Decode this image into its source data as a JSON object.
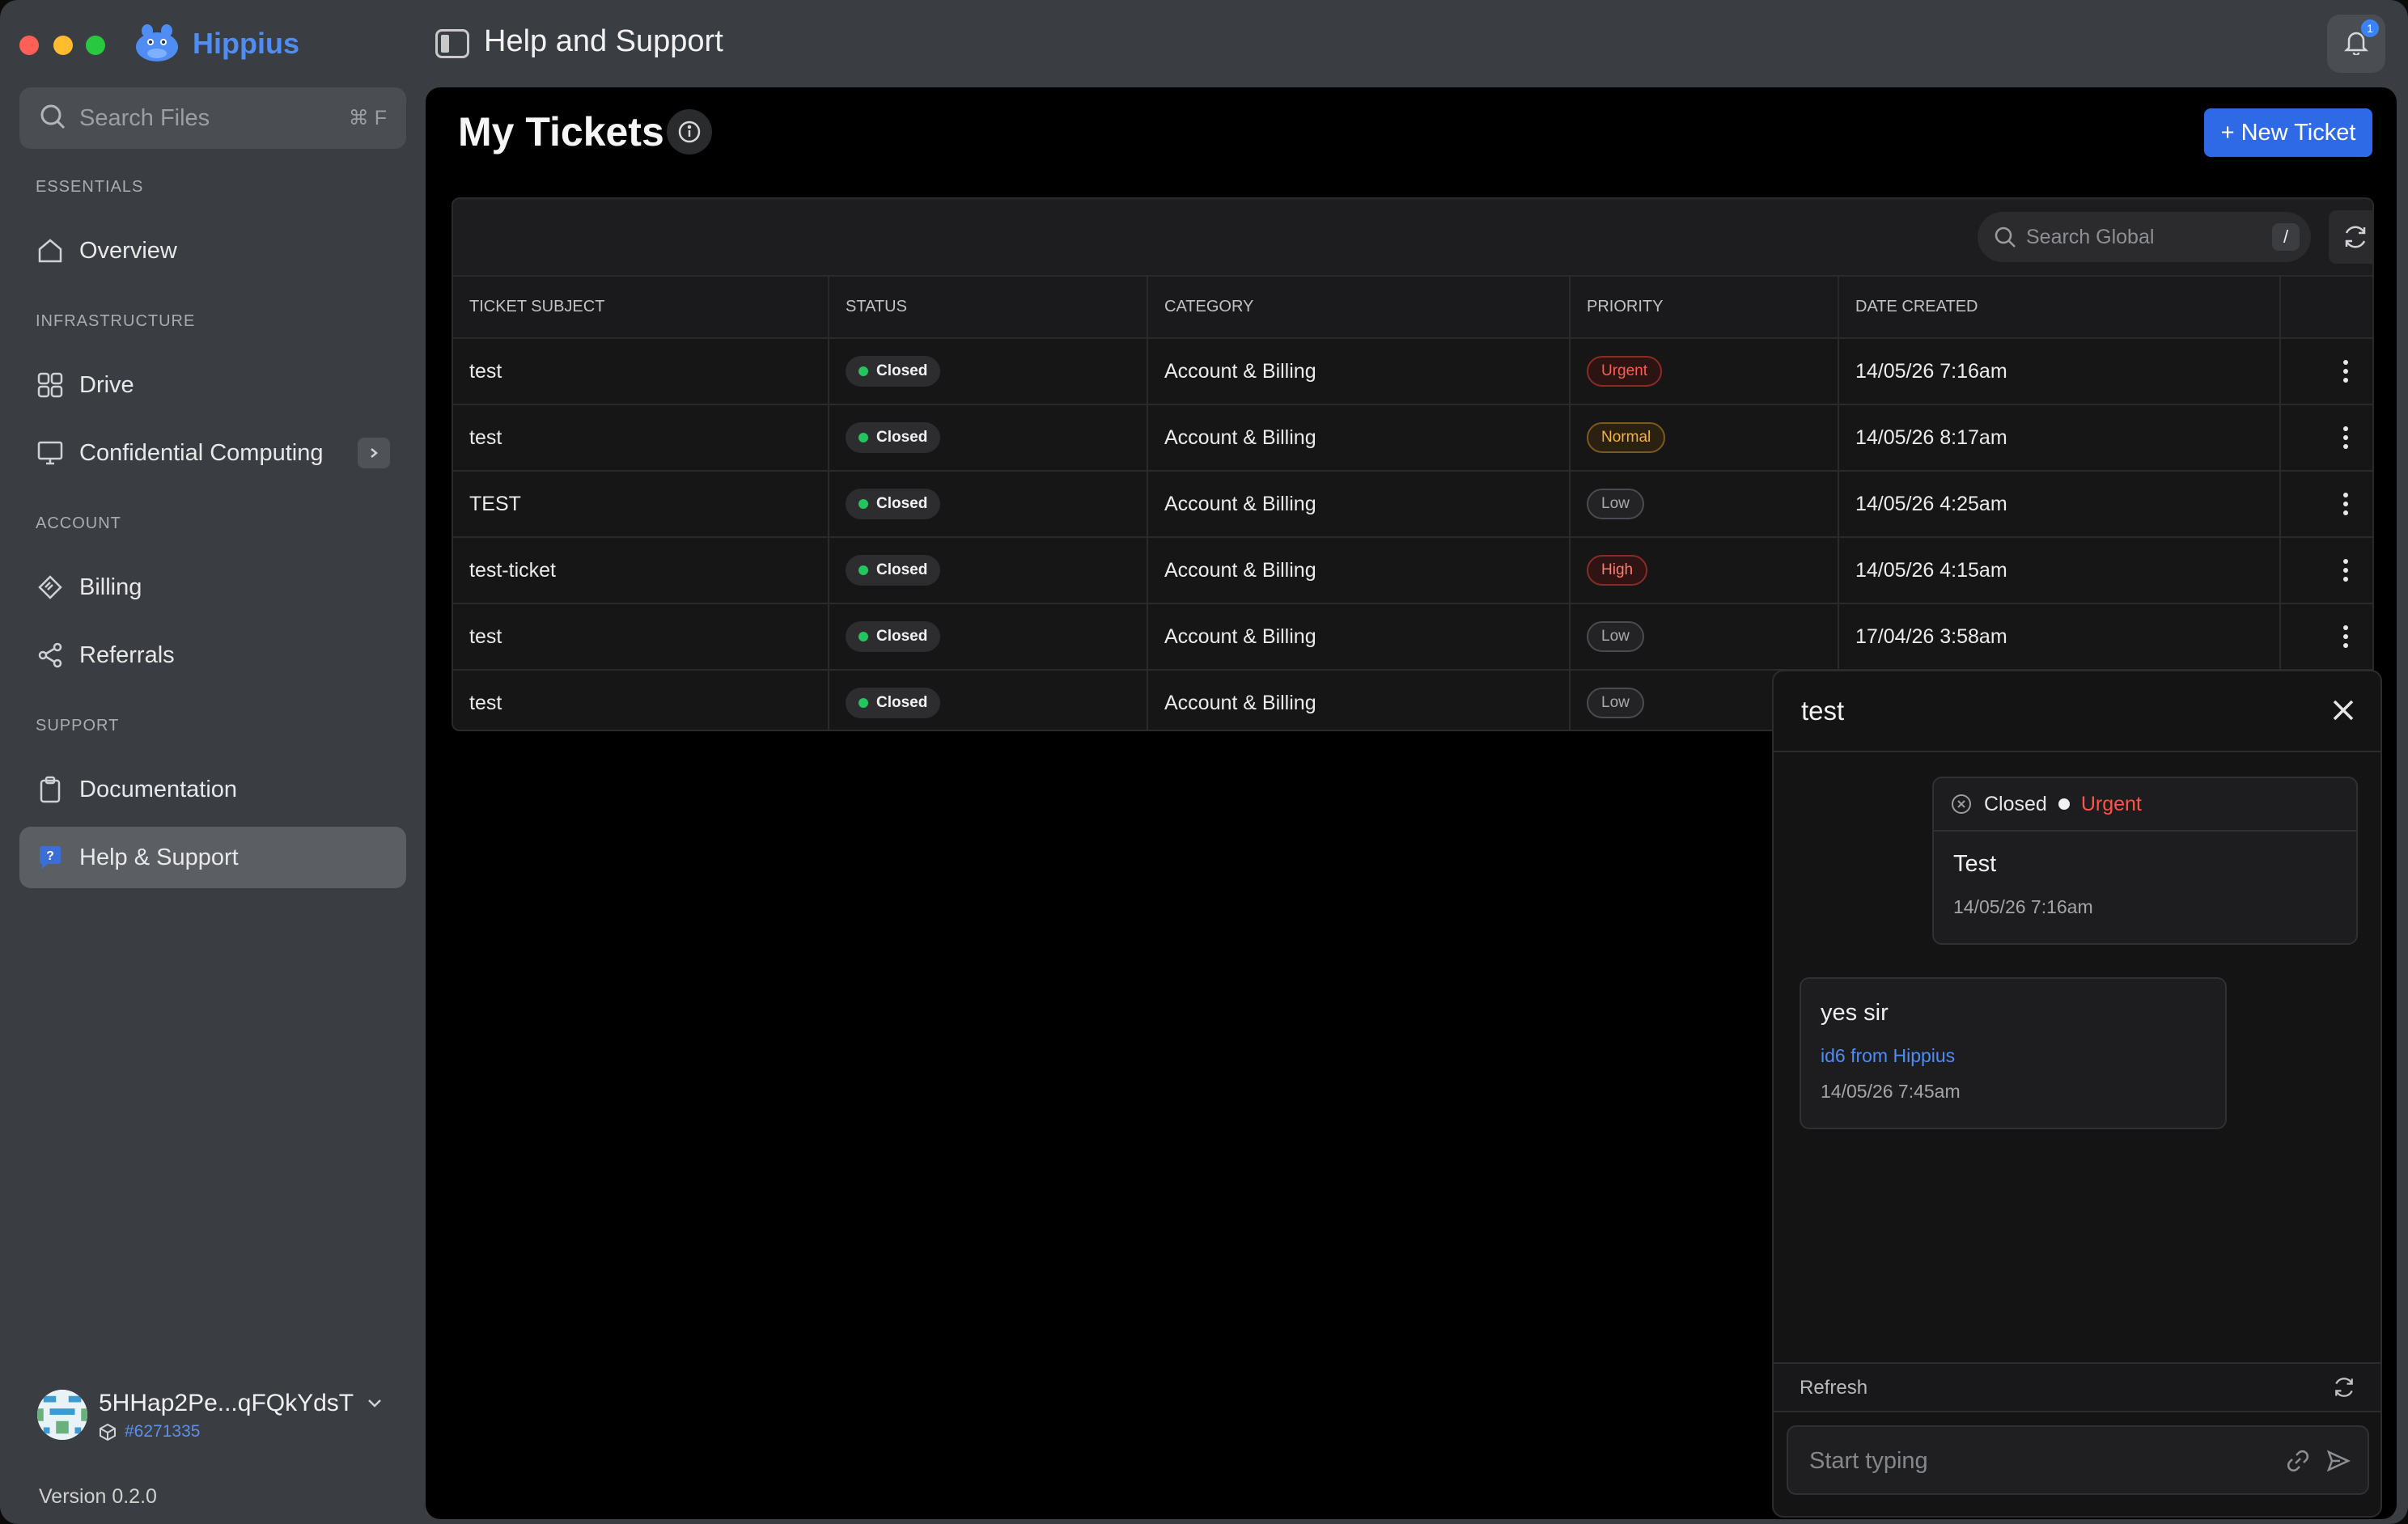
{
  "app": {
    "name": "Hippius",
    "page_heading": "Help and Support",
    "notification_count": "1",
    "accent": "#2f6ae6"
  },
  "sidebar": {
    "search": {
      "placeholder": "Search Files",
      "shortcut": "⌘ F"
    },
    "sections": {
      "essentials": "ESSENTIALS",
      "infrastructure": "INFRASTRUCTURE",
      "account": "ACCOUNT",
      "support": "SUPPORT"
    },
    "items": [
      {
        "label": "Overview",
        "icon": "home-icon"
      },
      {
        "label": "Drive",
        "icon": "grid-icon"
      },
      {
        "label": "Confidential Computing",
        "icon": "monitor-icon"
      },
      {
        "label": "Billing",
        "icon": "ticket-icon"
      },
      {
        "label": "Referrals",
        "icon": "share-icon"
      },
      {
        "label": "Documentation",
        "icon": "clipboard-icon"
      },
      {
        "label": "Help & Support",
        "icon": "help-chat-icon",
        "active": true
      }
    ],
    "account": {
      "name": "5HHap2Pe...qFQkYdsT",
      "id": "#6271335"
    },
    "version": "Version 0.2.0"
  },
  "main": {
    "title": "My Tickets",
    "new_ticket_label": "+ New Ticket",
    "search": {
      "placeholder": "Search Global",
      "shortcut": "/"
    },
    "columns": [
      "TICKET SUBJECT",
      "STATUS",
      "CATEGORY",
      "PRIORITY",
      "DATE CREATED"
    ],
    "rows": [
      {
        "subject": "test",
        "status": "Closed",
        "category": "Account & Billing",
        "priority": "Urgent",
        "date": "14/05/26 7:16am"
      },
      {
        "subject": "test",
        "status": "Closed",
        "category": "Account & Billing",
        "priority": "Normal",
        "date": "14/05/26 8:17am"
      },
      {
        "subject": "TEST",
        "status": "Closed",
        "category": "Account & Billing",
        "priority": "Low",
        "date": "14/05/26 4:25am"
      },
      {
        "subject": "test-ticket",
        "status": "Closed",
        "category": "Account & Billing",
        "priority": "High",
        "date": "14/05/26 4:15am"
      },
      {
        "subject": "test",
        "status": "Closed",
        "category": "Account & Billing",
        "priority": "Low",
        "date": "17/04/26 3:58am"
      },
      {
        "subject": "test",
        "status": "Closed",
        "category": "Account & Billing",
        "priority": "Low",
        "date": ""
      }
    ]
  },
  "panel": {
    "title": "test",
    "status": "Closed",
    "priority": "Urgent",
    "messages": [
      {
        "body": "Test",
        "time": "14/05/26 7:16am"
      },
      {
        "body": "yes sir",
        "from": "id6 from Hippius",
        "time": "14/05/26 7:45am"
      }
    ],
    "refresh_label": "Refresh",
    "composer_placeholder": "Start typing"
  }
}
